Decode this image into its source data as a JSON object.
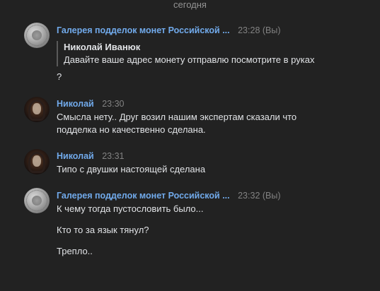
{
  "date_divider": "сегодня",
  "messages": [
    {
      "author": "Галерея подделок монет Российской ...",
      "time": "23:28 (Вы)",
      "quote": {
        "author": "Николай Иванюк",
        "text": "Давайте ваше адрес монету отправлю посмотрите в руках"
      },
      "text": "?"
    },
    {
      "author": "Николай",
      "time": "23:30",
      "lines": [
        "Смысла нету.. Друг возил нашим экспертам сказали что",
        "подделка но качественно сделана."
      ]
    },
    {
      "author": "Николай",
      "time": "23:31",
      "lines": [
        "Типо с двушки настоящей сделана"
      ]
    },
    {
      "author": "Галерея подделок монет Российской ...",
      "time": "23:32 (Вы)",
      "lines": [
        "К чему тогда пустословить было...",
        "Кто то за язык тянул?",
        "Трепло.."
      ]
    }
  ]
}
